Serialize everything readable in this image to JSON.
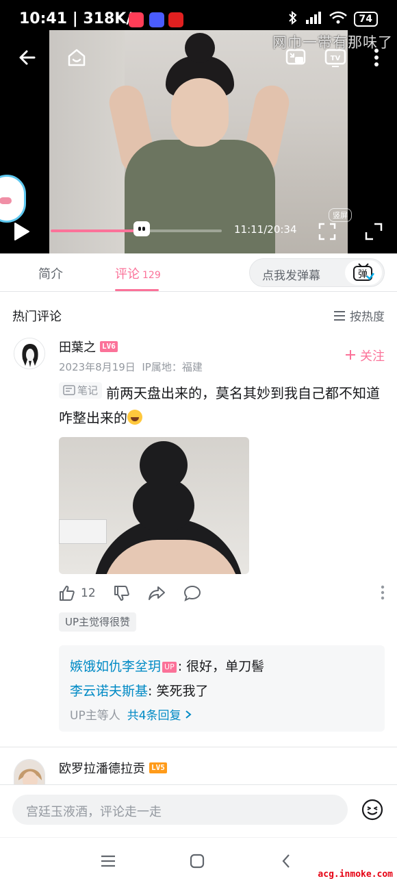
{
  "statusbar": {
    "time": "10:41 | 318K/s",
    "battery": "74"
  },
  "video": {
    "watermark": "网巾一带有那味了",
    "current_time": "11:11/20:34",
    "vertical_label": "竖屏",
    "progress": 0.53
  },
  "tabs": [
    {
      "label": "简介"
    },
    {
      "label": "评论",
      "count": "129"
    }
  ],
  "danmaku": {
    "placeholder": "点我发弹幕",
    "button": "弹"
  },
  "comments_section": {
    "title": "热门评论",
    "sort_label": "按热度"
  },
  "comment": {
    "username": "田葉之",
    "level": "LV6",
    "level_color": "#fb7299",
    "date": "2023年8月19日",
    "ip": "IP属地：福建",
    "follow_label": "关注",
    "note_tag": "笔记",
    "text": "前两天盘出来的，莫名其妙到我自己都不知道咋整出来的",
    "likes": "12",
    "up_tag": "UP主觉得很赞",
    "replies": [
      {
        "name": "嫉饿如仇李坌玥",
        "up": "UP",
        "text": ": 很好，单刀髻"
      },
      {
        "name": "李云诺夫斯基",
        "text": ": 笑死我了"
      }
    ],
    "reply_summary": "UP主等人",
    "reply_link": "共4条回复"
  },
  "next_comment": {
    "username": "欧罗拉潘德拉贡",
    "level": "LV5",
    "level_color": "#ff9b1a"
  },
  "input": {
    "placeholder": "宫廷玉液酒，评论走一走"
  },
  "site_mark": "acg.inmoke.com"
}
